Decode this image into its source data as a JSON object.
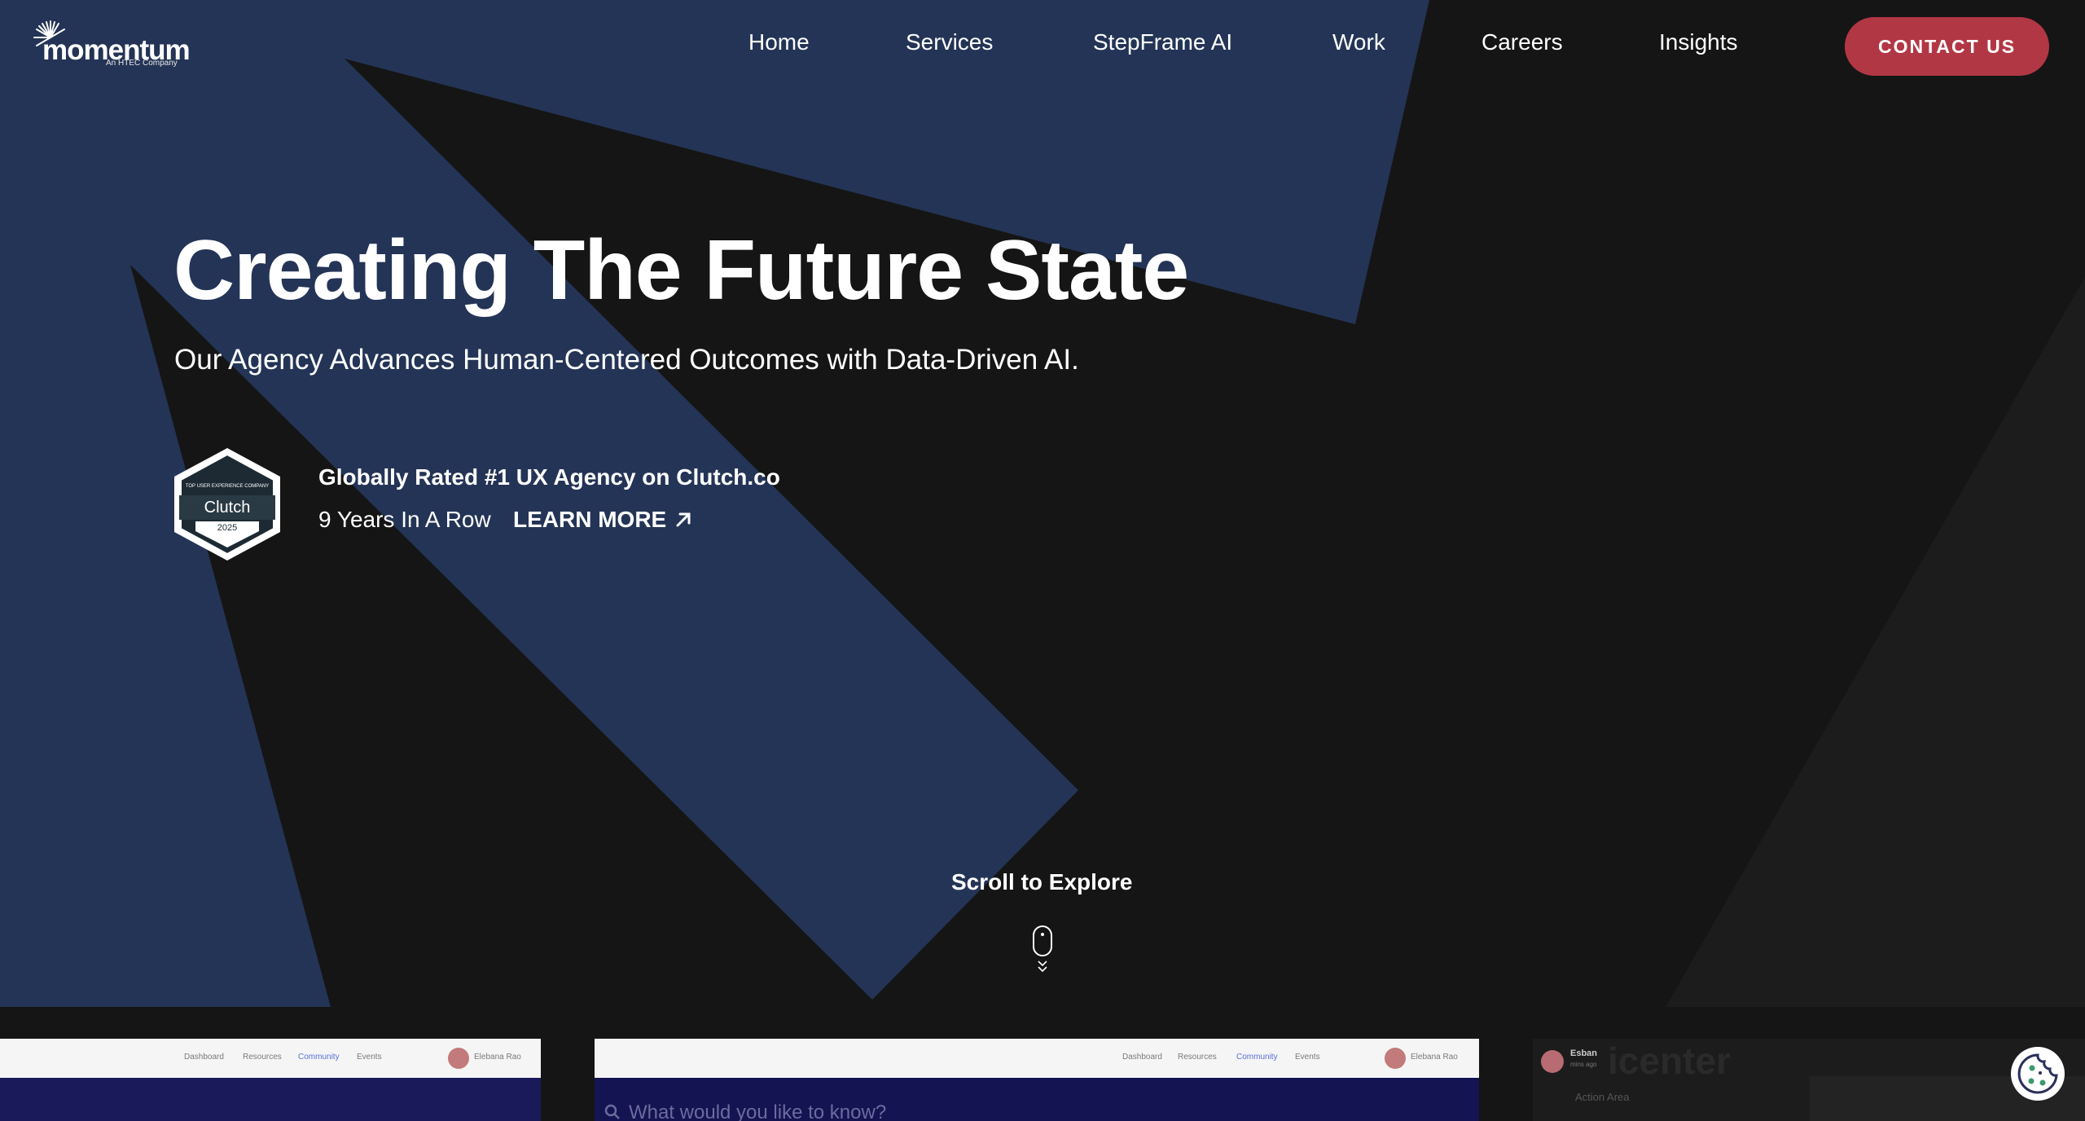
{
  "brand": {
    "name": "momentum",
    "tagline": "An HTEC Company"
  },
  "nav": {
    "items": [
      {
        "label": "Home"
      },
      {
        "label": "Services"
      },
      {
        "label": "StepFrame AI"
      },
      {
        "label": "Work"
      },
      {
        "label": "Careers"
      },
      {
        "label": "Insights"
      }
    ],
    "cta_label": "CONTACT US"
  },
  "hero": {
    "title": "Creating The Future State",
    "subtitle": "Our Agency Advances Human-Centered Outcomes with Data-Driven AI."
  },
  "clutch": {
    "badge_top": "TOP USER EXPERIENCE COMPANY",
    "badge_name": "Clutch",
    "badge_year": "2025",
    "headline": "Globally Rated #1 UX Agency on Clutch.co",
    "years": "9 Years In A Row",
    "learn_more": "LEARN MORE"
  },
  "scroll": {
    "label": "Scroll to Explore"
  },
  "previews": {
    "card1": {
      "nav": [
        "Dashboard",
        "Resources",
        "Community",
        "Events"
      ],
      "user": "Elebana Rao"
    },
    "card2": {
      "nav": [
        "Dashboard",
        "Resources",
        "Community",
        "Events"
      ],
      "user": "Elebana Rao",
      "search_placeholder": "What would you like to know?"
    },
    "card3": {
      "title": "icenter",
      "user": "Esban",
      "user_sub": "mins ago",
      "item": "Action Area"
    }
  },
  "colors": {
    "background": "#151515",
    "shape_blue": "#243456",
    "cta": "#b23744"
  },
  "icons": {
    "learn_more": "arrow-up-right-icon",
    "scroll": "mouse-scroll-icon",
    "cookie": "cookie-icon"
  }
}
